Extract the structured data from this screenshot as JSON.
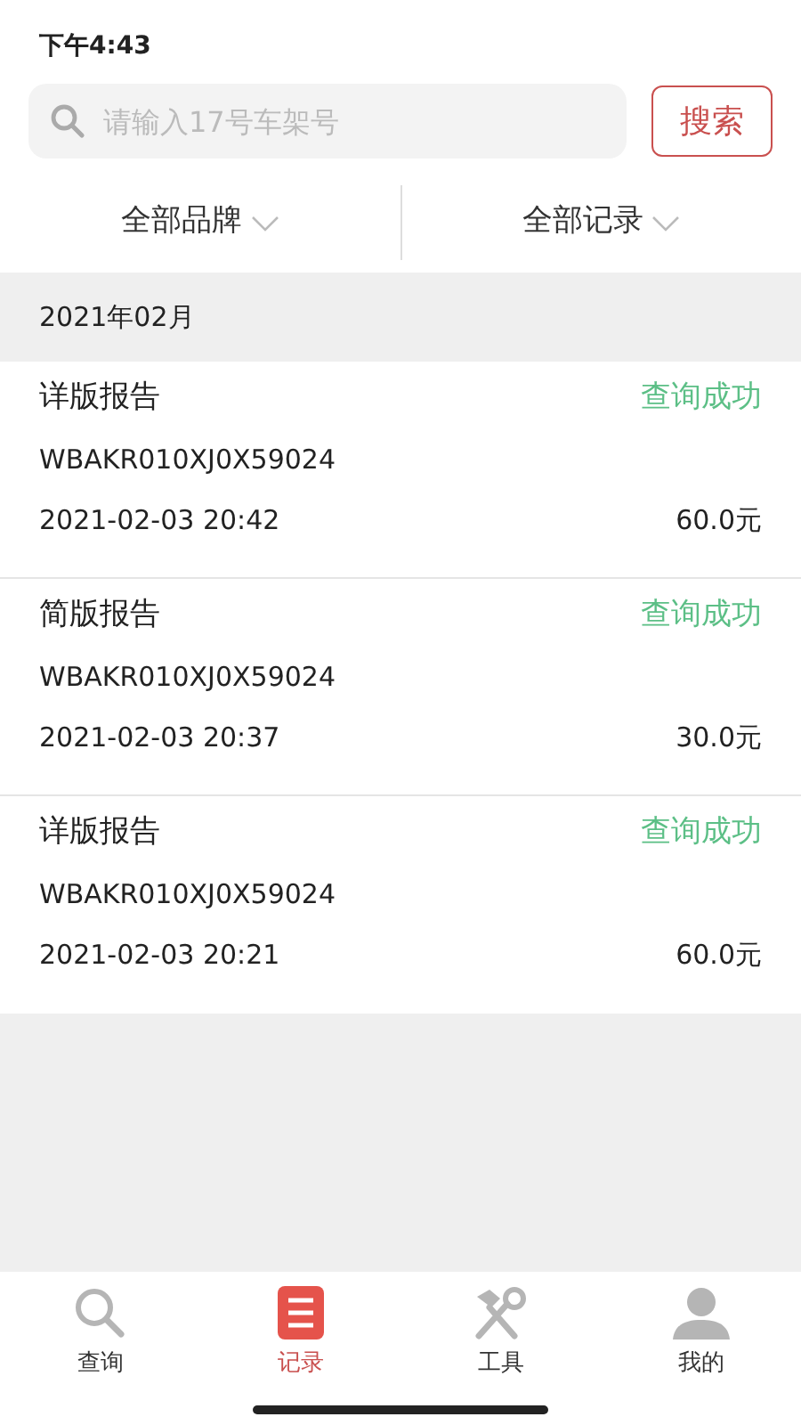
{
  "status_bar": {
    "time": "下午4:43"
  },
  "search": {
    "placeholder": "请输入17号车架号",
    "button": "搜索"
  },
  "filters": [
    {
      "label": "全部品牌"
    },
    {
      "label": "全部记录"
    }
  ],
  "month": "2021年02月",
  "records": [
    {
      "type": "详版报告",
      "status": "查询成功",
      "vin": "WBAKR010XJ0X59024",
      "time": "2021-02-03 20:42",
      "price": "60.0元"
    },
    {
      "type": "简版报告",
      "status": "查询成功",
      "vin": "WBAKR010XJ0X59024",
      "time": "2021-02-03 20:37",
      "price": "30.0元"
    },
    {
      "type": "详版报告",
      "status": "查询成功",
      "vin": "WBAKR010XJ0X59024",
      "time": "2021-02-03 20:21",
      "price": "60.0元"
    }
  ],
  "tabs": [
    {
      "kind": "search",
      "label": "查询",
      "selected": false
    },
    {
      "kind": "records",
      "label": "记录",
      "selected": true
    },
    {
      "kind": "tools",
      "label": "工具",
      "selected": false
    },
    {
      "kind": "profile",
      "label": "我的",
      "selected": false
    }
  ]
}
